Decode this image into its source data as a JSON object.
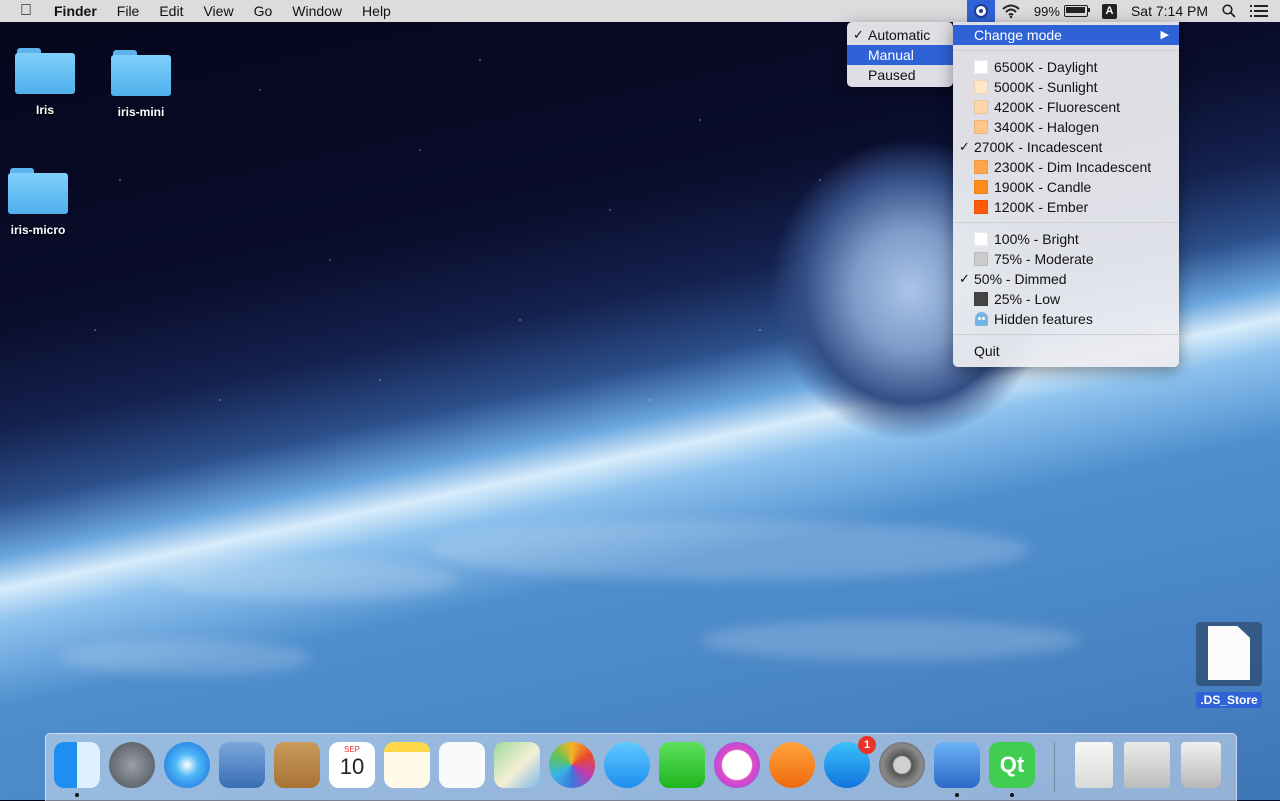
{
  "menubar": {
    "app_name": "Finder",
    "menus": [
      "File",
      "Edit",
      "View",
      "Go",
      "Window",
      "Help"
    ],
    "battery": "99%",
    "input_source": "A",
    "clock": "Sat 7:14 PM"
  },
  "desktop": {
    "icons": [
      {
        "label": "Iris",
        "type": "folder"
      },
      {
        "label": "iris-mini",
        "type": "folder"
      },
      {
        "label": "iris-micro",
        "type": "folder"
      },
      {
        "label": ".DS_Store",
        "type": "file"
      }
    ]
  },
  "mode_submenu": {
    "items": [
      {
        "label": "Automatic",
        "checked": true
      },
      {
        "label": "Manual",
        "highlighted": true
      },
      {
        "label": "Paused"
      }
    ]
  },
  "iris_menu": {
    "change_mode": "Change mode",
    "temperature": [
      {
        "label": "6500K - Daylight",
        "color": "#ffffff"
      },
      {
        "label": "5000K - Sunlight",
        "color": "#ffe6c9"
      },
      {
        "label": "4200K - Fluorescent",
        "color": "#ffd6aa"
      },
      {
        "label": "3400K - Halogen",
        "color": "#ffc58a"
      },
      {
        "label": "2700K - Incadescent",
        "checked": true
      },
      {
        "label": "2300K - Dim Incadescent",
        "color": "#ffa64a"
      },
      {
        "label": "1900K - Candle",
        "color": "#ff8c1a"
      },
      {
        "label": "1200K - Ember",
        "color": "#ff5a0a"
      }
    ],
    "brightness": [
      {
        "label": "100% - Bright",
        "color": "#ffffff"
      },
      {
        "label": "75% - Moderate",
        "color": "#cccccc"
      },
      {
        "label": "50% - Dimmed",
        "checked": true
      },
      {
        "label": "25% - Low",
        "color": "#444444"
      }
    ],
    "hidden_features": "Hidden features",
    "quit": "Quit"
  },
  "dock": {
    "calendar_month": "SEP",
    "calendar_day": "10",
    "app_store_badge": "1",
    "qt_label": "Qt"
  }
}
